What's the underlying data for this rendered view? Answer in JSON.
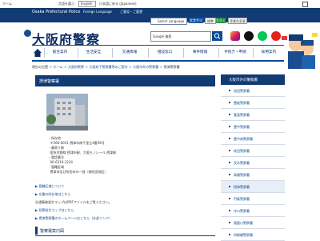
{
  "top": {
    "home_text": "ホーム",
    "lang_prefix": "言語を選ぶ",
    "lang_select": "English",
    "lang_suffix": "日本語に戻る (Japanese)"
  },
  "band": {
    "osaka_police": "Osaka Prefectural Police",
    "foreign_language": "Foreign Language",
    "pref_site": "ご意見・ご要望",
    "select_language": "Select Language",
    "buttons": [
      "文字サイズ",
      "標準",
      "大きく",
      "背景色変更"
    ]
  },
  "header": {
    "title": "大阪府警察",
    "search_placeholder": "Google 検索"
  },
  "nav": [
    "総合案内",
    "生活安全",
    "交通情報",
    "相談窓口",
    "事件情報",
    "手続き・申請",
    "採用案内"
  ],
  "breadcrumb": [
    "現在の位置",
    "ホーム",
    "大阪府警察",
    "大阪府下警察署等のご案内",
    "大阪市外の警察署",
    "摂津警察署"
  ],
  "main": {
    "heading": "摂津警察署",
    "address_label": "所在地",
    "address_value": "〒566-0021 摂津市南千里丘4番39号",
    "station_label": "最寄り駅",
    "station_value": "阪急京都線 摂津市駅、大阪モノレール 摂津駅",
    "phone_label": "電話番号",
    "phone_value": "06-6319-1234",
    "area_label": "管轄区域",
    "area_value": "摂津市及び吹田市の一部（南吹田地区）",
    "links": [
      "管轄区域について",
      "交番の所在地はこちら",
      "交通事故発生マップはPDFファイルをご覧ください。",
      "犯罪発生マップはこちら",
      "摂津警察署のホームページはこちら（外部リンク）"
    ],
    "section_heading": "警察署案内図"
  },
  "sidebar": {
    "heading": "大阪市外の警察署",
    "items": [
      "池田警察署",
      "豊能警察署",
      "箕面警察署",
      "豊中警察署",
      "豊中南警察署",
      "吹田警察署",
      "茨木警察署",
      "高槻警察署",
      "摂津警察署",
      "門真警察署",
      "守口警察署",
      "寝屋川警察署",
      "四條畷警察署"
    ]
  },
  "colors": {
    "navy": "#123a73",
    "link": "#0b4a95",
    "green": "#2b8a3e"
  }
}
